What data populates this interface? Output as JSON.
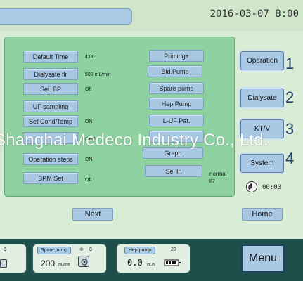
{
  "header": {
    "datetime": "2016-03-07  8:00"
  },
  "left_buttons": [
    {
      "label": "Default  Time",
      "value": "4:00"
    },
    {
      "label": "Dialysate  flr",
      "value": "500  mL/min"
    },
    {
      "label": "Sel. BP",
      "value": "Off"
    },
    {
      "label": "UF sampling",
      "value": ""
    },
    {
      "label": "Set  Cond/Temp",
      "value": "ON"
    },
    {
      "label": "",
      "value": "OFF"
    },
    {
      "label": "Operation  steps",
      "value": "ON"
    },
    {
      "label": "BPM Set",
      "value": "Off"
    }
  ],
  "mid_buttons": [
    {
      "label": "Priming+"
    },
    {
      "label": "Bld.Pump"
    },
    {
      "label": "Spare pump"
    },
    {
      "label": "Hep.Pump"
    },
    {
      "label": "L-UF  Par."
    },
    {
      "label": ""
    },
    {
      "label": "Graph"
    },
    {
      "label": "Sel In"
    }
  ],
  "sel_in_value": {
    "line1": "normal",
    "line2": "87"
  },
  "side_menu": [
    {
      "label": "Operation",
      "num": "1"
    },
    {
      "label": "Dialysate",
      "num": "2"
    },
    {
      "label": "KT/V",
      "num": "3"
    },
    {
      "label": "System",
      "num": "4"
    }
  ],
  "timer": "00:00",
  "next_label": "Next",
  "home_label": "Home",
  "bottom": {
    "partial_value": "8",
    "spare_pump": {
      "label": "Spare pump",
      "count": "8",
      "value": "200",
      "unit": "mL/min"
    },
    "hep_pump": {
      "label": "Hep.pump",
      "count": "20",
      "value": "0.0",
      "unit": "mL/h"
    },
    "menu_label": "Menu"
  },
  "watermark": "Shanghai Medeco Industry Co., Ltd.",
  "icons": [
    "clock-icon",
    "pump-icon",
    "syringe-icon"
  ]
}
